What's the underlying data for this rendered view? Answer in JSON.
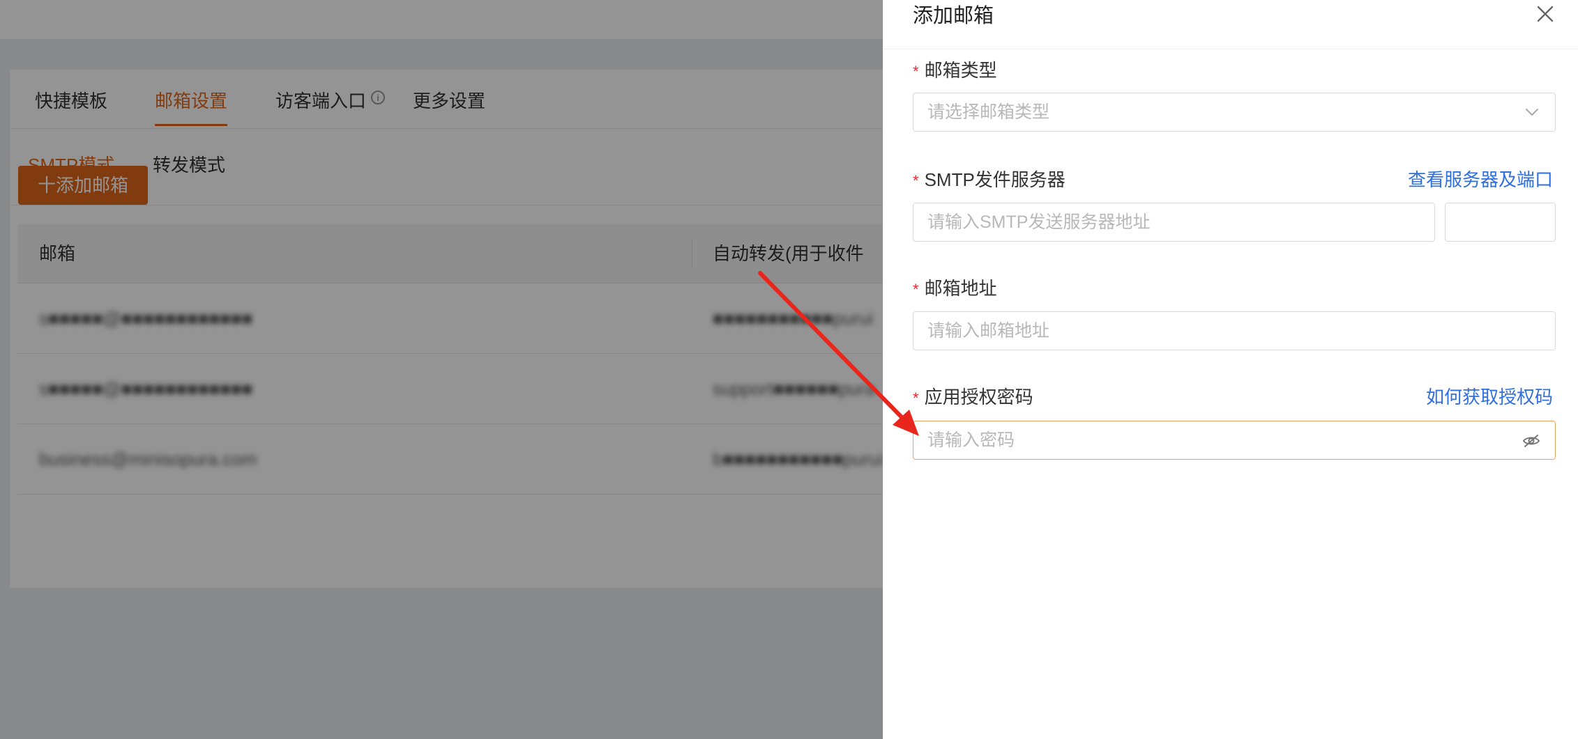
{
  "background": {
    "main_tabs": [
      {
        "label": "快捷模板",
        "active": false
      },
      {
        "label": "邮箱设置",
        "active": true
      },
      {
        "label": "访客端入口",
        "active": false
      },
      {
        "label": "更多设置",
        "active": false
      }
    ],
    "sub_tabs": [
      {
        "label": "SMTP模式",
        "active": true
      },
      {
        "label": "转发模式",
        "active": false
      }
    ],
    "add_button_label": "十添加邮箱",
    "table": {
      "columns": [
        "邮箱",
        "自动转发(用于收件"
      ],
      "rows": [
        [
          "s■■■■■@■■■■■■■■■■■■",
          "■■■■■■■■■■■purui"
        ],
        [
          "s■■■■■@■■■■■■■■■■■■",
          "support■■■■■■pura"
        ],
        [
          "business@minisopura.com",
          "b■■■■■■■■■■■purui"
        ]
      ]
    }
  },
  "drawer": {
    "title": "添加邮箱",
    "fields": {
      "mail_type": {
        "label": "邮箱类型",
        "placeholder": "请选择邮箱类型"
      },
      "smtp_server": {
        "label": "SMTP发件服务器",
        "link": "查看服务器及端口",
        "placeholder": "请输入SMTP发送服务器地址",
        "port_value": ""
      },
      "email_address": {
        "label": "邮箱地址",
        "placeholder": "请输入邮箱地址"
      },
      "auth_password": {
        "label": "应用授权密码",
        "link": "如何获取授权码",
        "placeholder": "请输入密码"
      }
    },
    "required_mark": "*"
  },
  "colors": {
    "accent": "#e0661b",
    "link": "#2f6fdf",
    "required": "#f5222d",
    "annotation_arrow": "#e8261c"
  }
}
